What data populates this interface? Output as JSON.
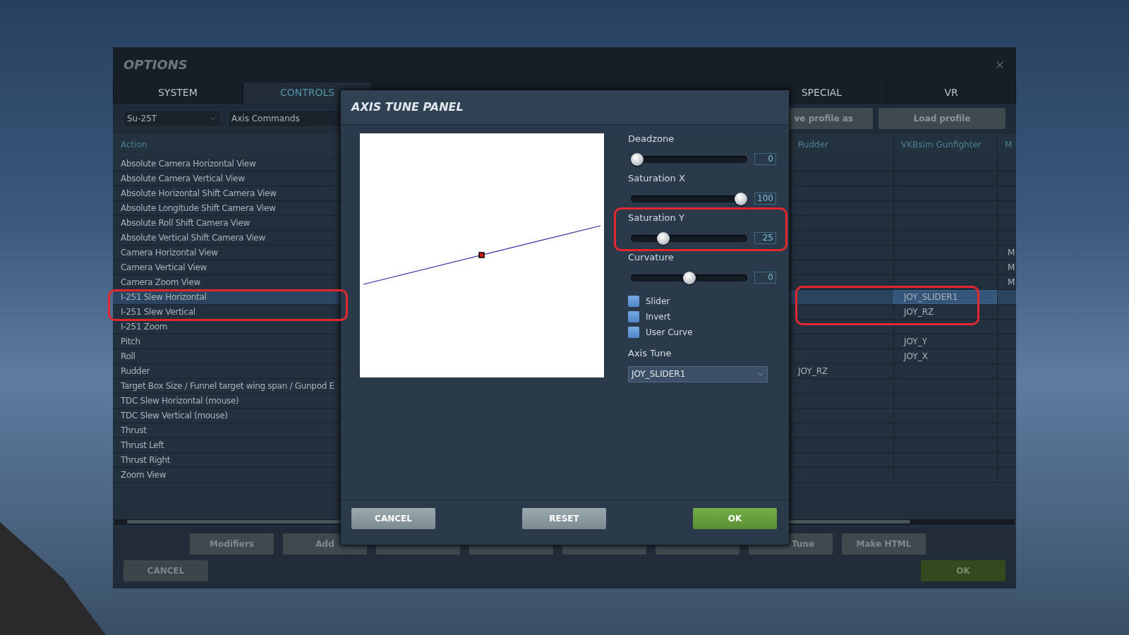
{
  "window": {
    "title": "OPTIONS"
  },
  "tabs": [
    {
      "label": "SYSTEM",
      "selected": false
    },
    {
      "label": "CONTROLS",
      "selected": true
    },
    {
      "label": "SPECIAL",
      "selected": false
    },
    {
      "label": "VR",
      "selected": false
    }
  ],
  "filters": [
    {
      "value": "Su-25T"
    },
    {
      "value": "Axis Commands"
    }
  ],
  "profile_buttons": [
    "ve profile as",
    "Load profile"
  ],
  "table": {
    "columns": [
      "Action",
      "Rudder",
      "VKBsim Gunfighter",
      "M"
    ],
    "rows": [
      {
        "action": "Absolute Camera Horizontal View",
        "selected": false
      },
      {
        "action": "Absolute Camera Vertical View",
        "selected": false
      },
      {
        "action": "Absolute Horizontal Shift Camera View",
        "selected": false
      },
      {
        "action": "Absolute Longitude Shift Camera View",
        "selected": false
      },
      {
        "action": "Absolute Roll Shift Camera View",
        "selected": false
      },
      {
        "action": "Absolute Vertical Shift Camera View",
        "selected": false
      },
      {
        "action": "Camera Horizontal View",
        "column_4": "M",
        "selected": false
      },
      {
        "action": "Camera Vertical View",
        "column_4": "M",
        "selected": false
      },
      {
        "action": "Camera Zoom View",
        "column_4": "M",
        "selected": false
      },
      {
        "action": "I-251 Slew Horizontal",
        "vkbsim": "JOY_SLIDER1",
        "selected": true
      },
      {
        "action": "I-251 Slew Vertical",
        "vkbsim": "JOY_RZ",
        "selected": false
      },
      {
        "action": "I-251 Zoom",
        "selected": false
      },
      {
        "action": "Pitch",
        "vkbsim": "JOY_Y",
        "selected": false
      },
      {
        "action": "Roll",
        "vkbsim": "JOY_X",
        "selected": false
      },
      {
        "action": "Rudder",
        "rudder": "JOY_RZ",
        "selected": false
      },
      {
        "action": "Target Box Size / Funnel target wing span / Gunpod E",
        "selected": false
      },
      {
        "action": "TDC Slew Horizontal (mouse)",
        "selected": false
      },
      {
        "action": "TDC Slew Vertical (mouse)",
        "selected": false
      },
      {
        "action": "Thrust",
        "selected": false
      },
      {
        "action": "Thrust Left",
        "selected": false
      },
      {
        "action": "Thrust Right",
        "selected": false
      },
      {
        "action": "Zoom View",
        "selected": false
      }
    ]
  },
  "toolbar_buttons": [
    "Modifiers",
    "Add",
    "Tune",
    "Make HTML"
  ],
  "footer": {
    "cancel": "CANCEL",
    "ok": "OK"
  },
  "dialog": {
    "title": "AXIS TUNE PANEL",
    "sliders": [
      {
        "label": "Deadzone",
        "level": 0,
        "reading": "0"
      },
      {
        "label": "Saturation X",
        "level": 1,
        "reading": "100"
      },
      {
        "label": "Saturation Y",
        "level": 0.25,
        "reading": "25"
      },
      {
        "label": "Curvature",
        "level": 0.5,
        "reading": "0"
      }
    ],
    "checkboxes": [
      {
        "label": "Slider",
        "checked": false
      },
      {
        "label": "Invert",
        "checked": false
      },
      {
        "label": "User Curve",
        "checked": false
      }
    ],
    "axis_tune": {
      "label": "Axis Tune",
      "value": "JOY_SLIDER1"
    },
    "buttons": [
      {
        "label": "CANCEL",
        "kind": "neutral"
      },
      {
        "label": "RESET",
        "kind": "neutral"
      },
      {
        "label": "OK",
        "kind": "primary"
      }
    ]
  }
}
